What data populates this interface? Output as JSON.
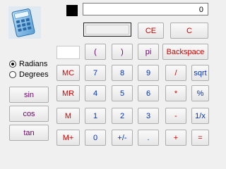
{
  "display": {
    "value": "0"
  },
  "angle_mode": {
    "options": [
      {
        "label": "Radians",
        "selected": true
      },
      {
        "label": "Degrees",
        "selected": false
      }
    ]
  },
  "buttons": {
    "ce": "CE",
    "c": "C",
    "open_paren": "(",
    "close_paren": ")",
    "pi": "pi",
    "backspace": "Backspace",
    "mc": "MC",
    "mr": "MR",
    "m": "M",
    "m_plus": "M+",
    "d7": "7",
    "d8": "8",
    "d9": "9",
    "d4": "4",
    "d5": "5",
    "d6": "6",
    "d1": "1",
    "d2": "2",
    "d3": "3",
    "d0": "0",
    "divide": "/",
    "multiply": "*",
    "subtract": "-",
    "add": "+",
    "equals": "=",
    "sqrt": "sqrt",
    "percent": "%",
    "reciprocal": "1/x",
    "negate": "+/-",
    "decimal": ".",
    "sin": "sin",
    "cos": "cos",
    "tan": "tan"
  },
  "colors": {
    "red": "#d00000",
    "blue": "#0033b4",
    "purple": "#6b006b"
  },
  "icons": {
    "app": "calculator-icon",
    "swatch": "color-swatch"
  }
}
